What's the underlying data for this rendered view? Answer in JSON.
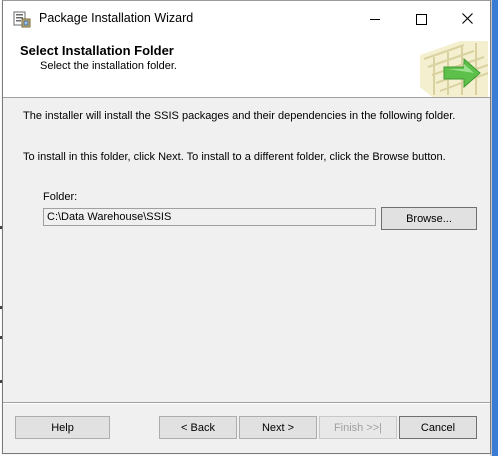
{
  "window": {
    "title": "Package Installation Wizard",
    "controls": {
      "minimize": "minimize-icon",
      "maximize": "maximize-icon",
      "close": "close-icon"
    }
  },
  "header": {
    "title": "Select Installation Folder",
    "subtitle": "Select the installation folder."
  },
  "body": {
    "paragraph1": "The installer will install the SSIS packages and their dependencies in the following folder.",
    "paragraph2": "To install in this folder, click Next. To install to a different folder, click the Browse button.",
    "folder_label": "Folder:",
    "folder_value": "C:\\Data Warehouse\\SSIS",
    "browse_label": "Browse..."
  },
  "footer": {
    "help_label": "Help",
    "back_label": "< Back",
    "next_label": "Next >",
    "finish_label": "Finish >>|",
    "cancel_label": "Cancel"
  },
  "colors": {
    "window_bg": "#f0f0f0",
    "header_bg": "#ffffff",
    "button_bg": "#e1e1e1",
    "graphic_green": "#5cc04a",
    "desktop_blue": "#3a7bd5"
  }
}
